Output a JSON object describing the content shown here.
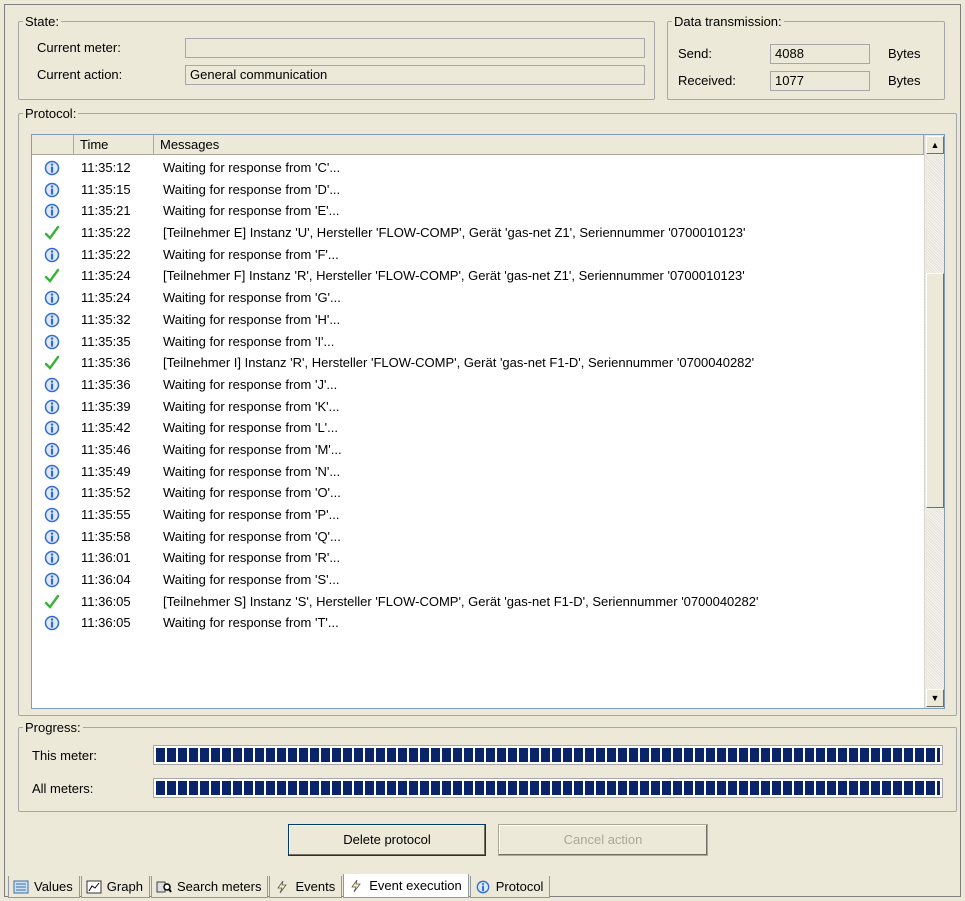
{
  "state": {
    "legend": "State:",
    "current_meter_label": "Current meter:",
    "current_meter_value": "",
    "current_action_label": "Current action:",
    "current_action_value": "General communication"
  },
  "data_transmission": {
    "legend": "Data transmission:",
    "send_label": "Send:",
    "send_value": "4088",
    "send_unit": "Bytes",
    "received_label": "Received:",
    "received_value": "1077",
    "received_unit": "Bytes"
  },
  "protocol": {
    "legend": "Protocol:",
    "columns": {
      "time": "Time",
      "messages": "Messages"
    },
    "rows": [
      {
        "type": "info",
        "time": "11:35:12",
        "msg": "Waiting for response from 'C'..."
      },
      {
        "type": "info",
        "time": "11:35:15",
        "msg": "Waiting for response from 'D'..."
      },
      {
        "type": "info",
        "time": "11:35:21",
        "msg": "Waiting for response from 'E'..."
      },
      {
        "type": "ok",
        "time": "11:35:22",
        "msg": "[Teilnehmer E] Instanz 'U', Hersteller 'FLOW-COMP', Gerät 'gas-net Z1', Seriennummer '0700010123'"
      },
      {
        "type": "info",
        "time": "11:35:22",
        "msg": "Waiting for response from 'F'..."
      },
      {
        "type": "ok",
        "time": "11:35:24",
        "msg": "[Teilnehmer F] Instanz 'R', Hersteller 'FLOW-COMP', Gerät 'gas-net Z1', Seriennummer '0700010123'"
      },
      {
        "type": "info",
        "time": "11:35:24",
        "msg": "Waiting for response from 'G'..."
      },
      {
        "type": "info",
        "time": "11:35:32",
        "msg": "Waiting for response from 'H'..."
      },
      {
        "type": "info",
        "time": "11:35:35",
        "msg": "Waiting for response from 'I'..."
      },
      {
        "type": "ok",
        "time": "11:35:36",
        "msg": "[Teilnehmer I] Instanz 'R', Hersteller 'FLOW-COMP', Gerät 'gas-net F1-D', Seriennummer '0700040282'"
      },
      {
        "type": "info",
        "time": "11:35:36",
        "msg": "Waiting for response from 'J'..."
      },
      {
        "type": "info",
        "time": "11:35:39",
        "msg": "Waiting for response from 'K'..."
      },
      {
        "type": "info",
        "time": "11:35:42",
        "msg": "Waiting for response from 'L'..."
      },
      {
        "type": "info",
        "time": "11:35:46",
        "msg": "Waiting for response from 'M'..."
      },
      {
        "type": "info",
        "time": "11:35:49",
        "msg": "Waiting for response from 'N'..."
      },
      {
        "type": "info",
        "time": "11:35:52",
        "msg": "Waiting for response from 'O'..."
      },
      {
        "type": "info",
        "time": "11:35:55",
        "msg": "Waiting for response from 'P'..."
      },
      {
        "type": "info",
        "time": "11:35:58",
        "msg": "Waiting for response from 'Q'..."
      },
      {
        "type": "info",
        "time": "11:36:01",
        "msg": "Waiting for response from 'R'..."
      },
      {
        "type": "info",
        "time": "11:36:04",
        "msg": "Waiting for response from 'S'..."
      },
      {
        "type": "ok",
        "time": "11:36:05",
        "msg": "[Teilnehmer S] Instanz 'S', Hersteller 'FLOW-COMP', Gerät 'gas-net F1-D', Seriennummer '0700040282'"
      },
      {
        "type": "info",
        "time": "11:36:05",
        "msg": "Waiting for response from 'T'..."
      }
    ]
  },
  "progress": {
    "legend": "Progress:",
    "this_meter_label": "This meter:",
    "this_meter_fraction": 1.0,
    "all_meters_label": "All meters:",
    "all_meters_fraction": 1.0
  },
  "buttons": {
    "delete_protocol": "Delete protocol",
    "cancel_action": "Cancel action"
  },
  "tabs": [
    {
      "label": "Values",
      "icon": "values-icon",
      "active": false
    },
    {
      "label": "Graph",
      "icon": "graph-icon",
      "active": false
    },
    {
      "label": "Search meters",
      "icon": "search-meters-icon",
      "active": false
    },
    {
      "label": "Events",
      "icon": "lightning-icon",
      "active": false
    },
    {
      "label": "Event execution",
      "icon": "lightning-icon",
      "active": true
    },
    {
      "label": "Protocol",
      "icon": "info-icon",
      "active": false
    }
  ],
  "colors": {
    "info_icon": "#2f6bd6",
    "ok_check": "#3ab13a",
    "progress_fill": "#0a246a"
  }
}
